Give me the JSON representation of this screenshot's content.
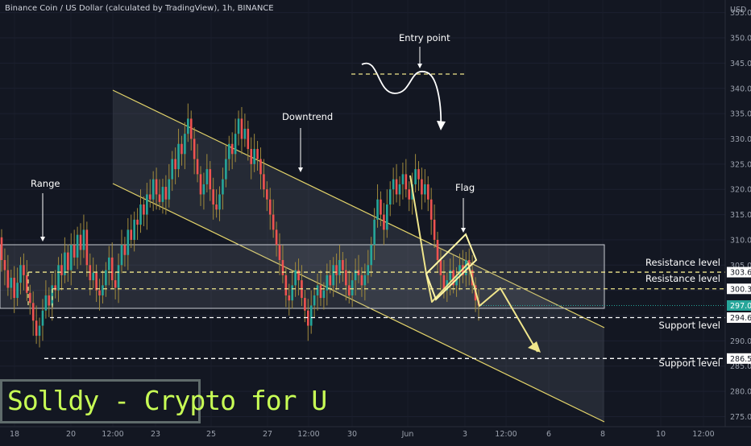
{
  "header": {
    "title": "Binance Coin / US Dollar (calculated by TradingView), 1h, BINANCE"
  },
  "brand": {
    "label": "Solldy - Crypto for U",
    "color": "#c8ff55"
  },
  "chart_data": {
    "type": "candlestick",
    "currency": "USD",
    "x_ticks": [
      "18",
      "20",
      "12:00",
      "23",
      "25",
      "27",
      "12:00",
      "30",
      "Jun",
      "3",
      "12:00",
      "6",
      "8",
      "10",
      "12:00"
    ],
    "y_ticks": [
      "355.0",
      "350.0",
      "345.0",
      "340.0",
      "335.0",
      "330.0",
      "325.0",
      "320.0",
      "315.0",
      "310.0",
      "305.0",
      "300.0",
      "295.0",
      "290.0",
      "285.0",
      "280.0",
      "275.0"
    ],
    "ylim": [
      273,
      357.5
    ],
    "price_levels": [
      {
        "value": 303.6,
        "label": "303.6",
        "text": "Resistance level",
        "style": "dashed",
        "color": "#f0e68c"
      },
      {
        "value": 300.3,
        "label": "300.3",
        "text": "Resistance level",
        "style": "dashed",
        "color": "#f0e68c"
      },
      {
        "value": 294.6,
        "label": "294.6",
        "text": "Support level",
        "style": "dashed",
        "color": "#ffffff"
      },
      {
        "value": 286.5,
        "label": "286.5",
        "text": "Support level",
        "style": "dashed",
        "color": "#ffffff"
      }
    ],
    "current_price": {
      "value": 297.0,
      "label": "297.0",
      "color": "#26a69a"
    },
    "range_zone": {
      "top": 309.0,
      "bottom": 296.5,
      "label": "Range"
    },
    "annotations": [
      "Range",
      "Downtrend",
      "Entry point",
      "Flag"
    ],
    "colors": {
      "up": "#26a69a",
      "down": "#ef5350",
      "wick": "#a08a3c",
      "channel": "#e3d36a"
    },
    "candles": [
      [
        310.5,
        306.0
      ],
      [
        306.0,
        304.0
      ],
      [
        304.0,
        300.5
      ],
      [
        300.5,
        302.5
      ],
      [
        302.5,
        298.5
      ],
      [
        298.5,
        301.5
      ],
      [
        301.5,
        305.0
      ],
      [
        305.0,
        303.0
      ],
      [
        303.0,
        299.5
      ],
      [
        299.5,
        297.5
      ],
      [
        297.5,
        294.0
      ],
      [
        294.0,
        291.0
      ],
      [
        291.0,
        293.0
      ],
      [
        293.0,
        296.0
      ],
      [
        296.0,
        299.0
      ],
      [
        299.0,
        297.0
      ],
      [
        297.0,
        301.0
      ],
      [
        301.0,
        300.0
      ],
      [
        300.0,
        305.0
      ],
      [
        305.0,
        303.0
      ],
      [
        303.0,
        307.5
      ],
      [
        307.5,
        304.0
      ],
      [
        304.0,
        309.0
      ],
      [
        309.0,
        306.5
      ],
      [
        306.5,
        311.0
      ],
      [
        311.0,
        308.0
      ],
      [
        308.0,
        312.0
      ],
      [
        312.0,
        305.0
      ],
      [
        305.0,
        302.0
      ],
      [
        302.0,
        303.5
      ],
      [
        303.5,
        300.0
      ],
      [
        300.0,
        299.0
      ],
      [
        299.0,
        301.0
      ],
      [
        301.0,
        304.0
      ],
      [
        304.0,
        306.5
      ],
      [
        306.5,
        302.0
      ],
      [
        302.0,
        300.5
      ],
      [
        300.5,
        305.0
      ],
      [
        305.0,
        309.0
      ],
      [
        309.0,
        307.0
      ],
      [
        307.0,
        312.0
      ],
      [
        312.0,
        310.0
      ],
      [
        310.0,
        314.0
      ],
      [
        314.0,
        313.0
      ],
      [
        313.0,
        317.0
      ],
      [
        317.0,
        315.0
      ],
      [
        315.0,
        319.0
      ],
      [
        319.0,
        318.0
      ],
      [
        318.0,
        322.0
      ],
      [
        322.0,
        319.0
      ],
      [
        319.0,
        317.5
      ],
      [
        317.5,
        320.5
      ],
      [
        320.5,
        318.0
      ],
      [
        318.0,
        322.0
      ],
      [
        322.0,
        326.0
      ],
      [
        326.0,
        324.0
      ],
      [
        324.0,
        329.0
      ],
      [
        329.0,
        327.0
      ],
      [
        327.0,
        331.0
      ],
      [
        331.0,
        334.0
      ],
      [
        334.0,
        330.0
      ],
      [
        330.0,
        326.0
      ],
      [
        326.0,
        323.0
      ],
      [
        323.0,
        319.0
      ],
      [
        319.0,
        321.0
      ],
      [
        321.0,
        324.0
      ],
      [
        324.0,
        320.0
      ],
      [
        320.0,
        317.0
      ],
      [
        317.0,
        316.0
      ],
      [
        316.0,
        319.0
      ],
      [
        319.0,
        322.0
      ],
      [
        322.0,
        326.0
      ],
      [
        326.0,
        329.0
      ],
      [
        329.0,
        327.0
      ],
      [
        327.0,
        331.0
      ],
      [
        331.0,
        334.0
      ],
      [
        334.0,
        330.0
      ],
      [
        330.0,
        332.0
      ],
      [
        332.0,
        328.0
      ],
      [
        328.0,
        325.0
      ],
      [
        325.0,
        328.0
      ],
      [
        328.0,
        326.0
      ],
      [
        326.0,
        323.0
      ],
      [
        323.0,
        320.0
      ],
      [
        320.0,
        318.0
      ],
      [
        318.0,
        315.0
      ],
      [
        315.0,
        312.0
      ],
      [
        312.0,
        309.0
      ],
      [
        309.0,
        306.0
      ],
      [
        306.0,
        303.0
      ],
      [
        303.0,
        299.0
      ],
      [
        299.0,
        298.0
      ],
      [
        298.0,
        301.0
      ],
      [
        301.0,
        304.0
      ],
      [
        304.0,
        302.0
      ],
      [
        302.0,
        298.5
      ],
      [
        298.5,
        296.0
      ],
      [
        296.0,
        293.0
      ],
      [
        293.0,
        297.0
      ],
      [
        297.0,
        299.0
      ],
      [
        299.0,
        301.0
      ],
      [
        301.0,
        298.5
      ],
      [
        298.5,
        300.0
      ],
      [
        300.0,
        303.0
      ],
      [
        303.0,
        301.0
      ],
      [
        301.0,
        305.0
      ],
      [
        305.0,
        303.0
      ],
      [
        303.0,
        306.0
      ],
      [
        306.0,
        304.0
      ],
      [
        304.0,
        301.0
      ],
      [
        301.0,
        299.0
      ],
      [
        299.0,
        302.0
      ],
      [
        302.0,
        304.0
      ],
      [
        304.0,
        303.0
      ],
      [
        303.0,
        301.0
      ],
      [
        301.0,
        303.0
      ],
      [
        303.0,
        305.0
      ],
      [
        305.0,
        309.0
      ],
      [
        309.0,
        314.0
      ],
      [
        314.0,
        318.0
      ],
      [
        318.0,
        315.0
      ],
      [
        315.0,
        312.0
      ],
      [
        312.0,
        317.0
      ],
      [
        317.0,
        320.0
      ],
      [
        320.0,
        322.0
      ],
      [
        322.0,
        319.0
      ],
      [
        319.0,
        321.0
      ],
      [
        321.0,
        323.0
      ],
      [
        323.0,
        320.0
      ],
      [
        320.0,
        318.0
      ],
      [
        318.0,
        321.0
      ],
      [
        321.0,
        324.0
      ],
      [
        324.0,
        322.0
      ],
      [
        322.0,
        319.0
      ],
      [
        319.0,
        321.0
      ],
      [
        321.0,
        318.0
      ],
      [
        318.0,
        314.0
      ],
      [
        314.0,
        310.0
      ],
      [
        310.0,
        306.0
      ],
      [
        306.0,
        303.0
      ],
      [
        303.0,
        300.0
      ],
      [
        300.0,
        302.0
      ],
      [
        302.0,
        304.0
      ],
      [
        304.0,
        301.0
      ],
      [
        301.0,
        303.0
      ],
      [
        303.0,
        305.0
      ],
      [
        305.0,
        303.0
      ],
      [
        303.0,
        306.0
      ],
      [
        306.0,
        304.0
      ],
      [
        304.0,
        301.0
      ],
      [
        301.0,
        298.0
      ],
      [
        298.0,
        297.0
      ]
    ]
  }
}
